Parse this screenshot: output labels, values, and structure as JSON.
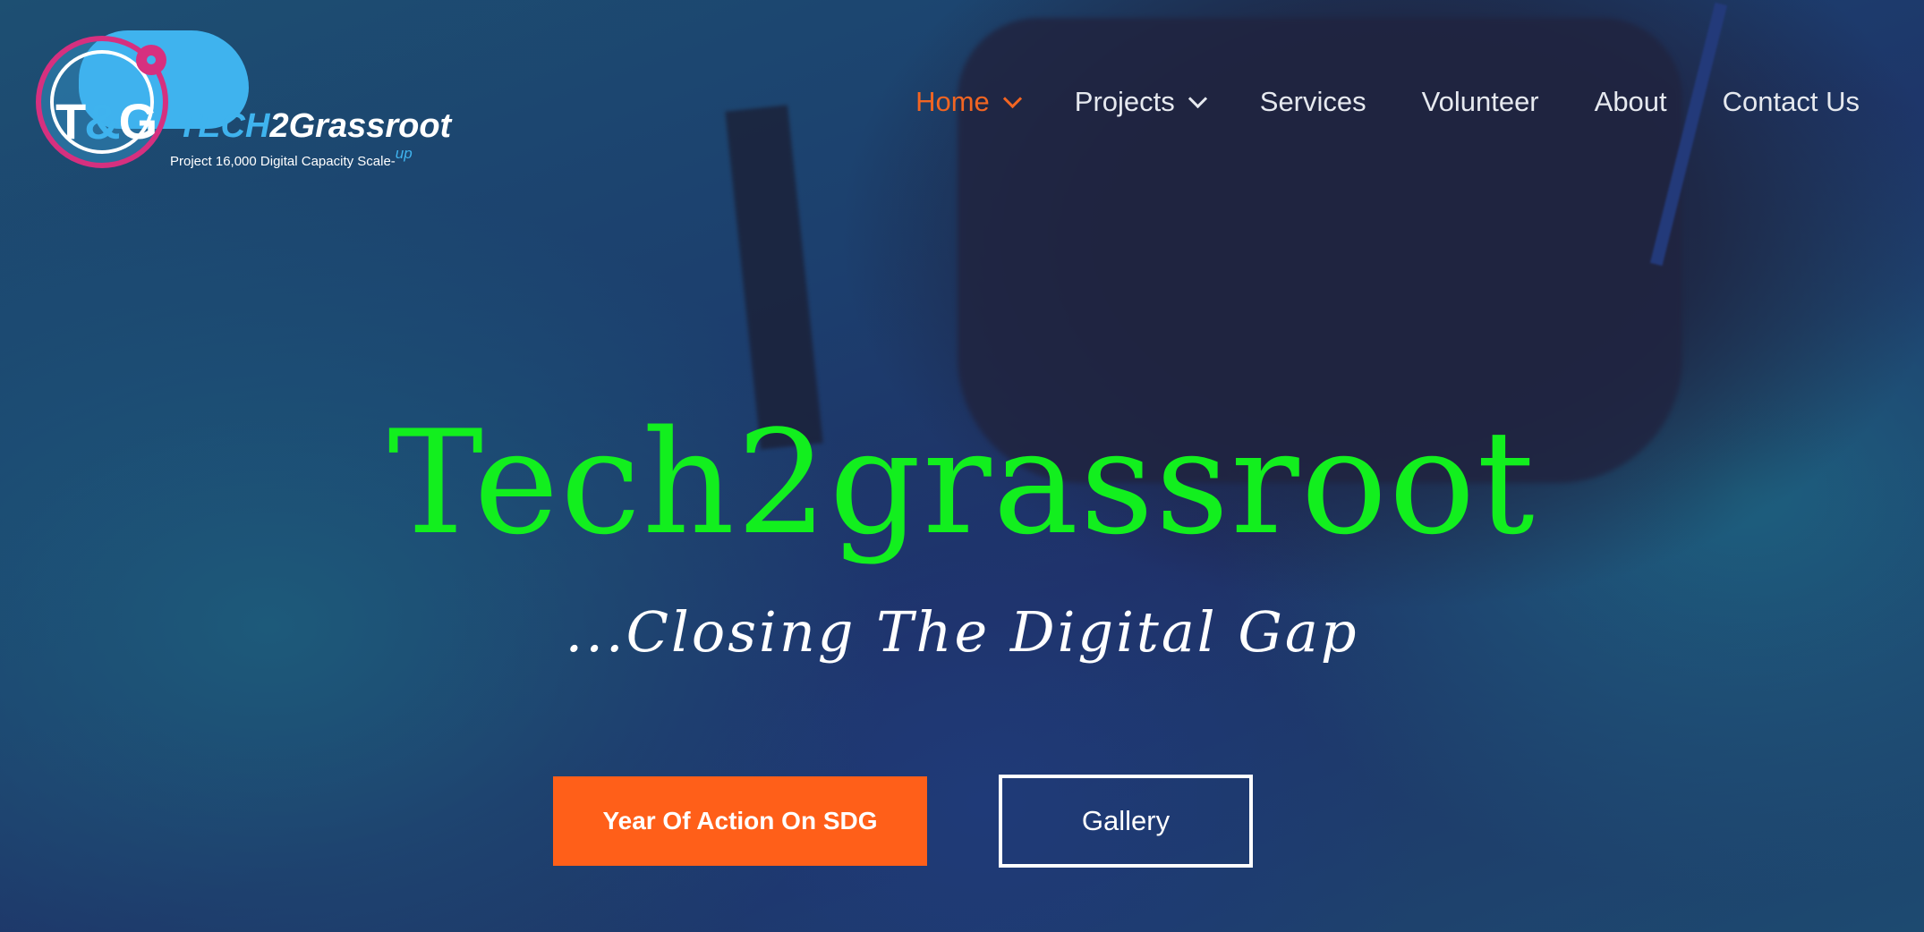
{
  "logo": {
    "mark_t": "T",
    "mark_amp": "&",
    "mark_g": "G",
    "word_tech": "TECH",
    "word_2grassroot": "2Grassroot",
    "tagline": "Project 16,000 Digital Capacity Scale-",
    "tagline_up": "up"
  },
  "nav": {
    "items": [
      {
        "label": "Home",
        "active": true,
        "dropdown": true
      },
      {
        "label": "Projects",
        "active": false,
        "dropdown": true
      },
      {
        "label": "Services",
        "active": false,
        "dropdown": false
      },
      {
        "label": "Volunteer",
        "active": false,
        "dropdown": false
      },
      {
        "label": "About",
        "active": false,
        "dropdown": false
      },
      {
        "label": "Contact Us",
        "active": false,
        "dropdown": false
      }
    ]
  },
  "hero": {
    "title": "Tech2grassroot",
    "subtitle": "...Closing The Digital Gap",
    "primary_button": "Year Of Action On SDG",
    "secondary_button": "Gallery"
  },
  "colors": {
    "accent": "#ff5f19",
    "title_green": "#12ef1e",
    "nav_active": "#f26522",
    "logo_blue": "#3fb3ee",
    "logo_pink": "#d6307f"
  }
}
